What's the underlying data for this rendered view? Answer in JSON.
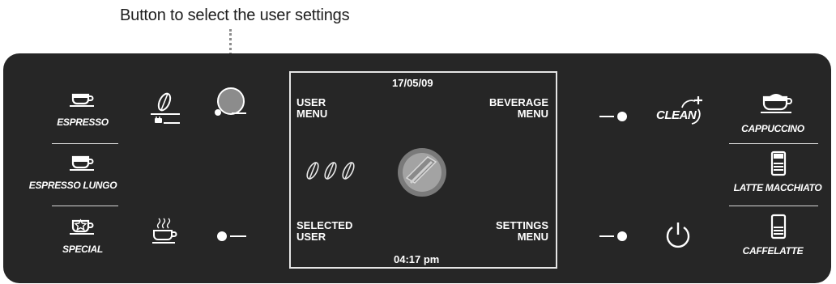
{
  "annotation": {
    "text": "Button to select the user settings"
  },
  "left_beverages": [
    {
      "label": "ESPRESSO",
      "icon": "espresso-cup-icon"
    },
    {
      "label": "ESPRESSO LUNGO",
      "icon": "espresso-lungo-cup-icon"
    },
    {
      "label": "SPECIAL",
      "icon": "special-cup-icon"
    }
  ],
  "right_beverages": [
    {
      "label": "CAPPUCCINO",
      "icon": "cappuccino-cup-icon"
    },
    {
      "label": "LATTE MACCHIATO",
      "icon": "latte-macchiato-glass-icon"
    },
    {
      "label": "CAFFELATTE",
      "icon": "caffelatte-glass-icon"
    }
  ],
  "display": {
    "date": "17/05/09",
    "time": "04:17 pm",
    "user_menu": [
      "USER",
      "MENU"
    ],
    "beverage_menu": [
      "BEVERAGE",
      "MENU"
    ],
    "selected_user": [
      "SELECTED",
      "USER"
    ],
    "settings_menu": [
      "SETTINGS",
      "MENU"
    ]
  },
  "clean_label": "CLEAN",
  "colors": {
    "panel": "#262626",
    "accent": "#ffffff",
    "selected_button": "#8c8c8c",
    "leader": "#8c8c8c"
  }
}
